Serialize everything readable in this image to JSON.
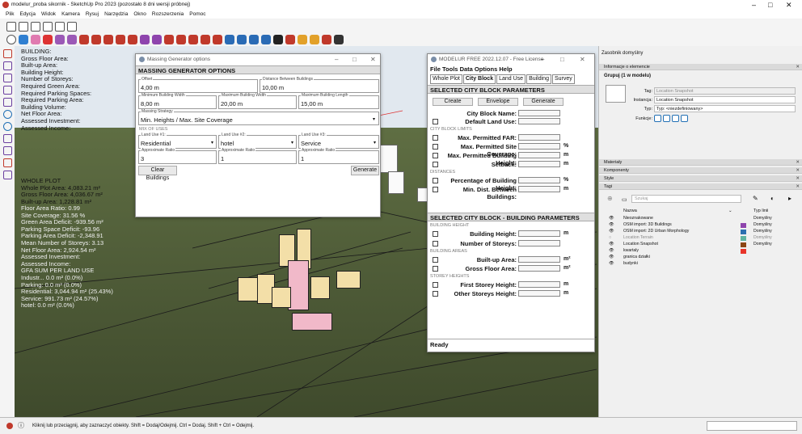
{
  "window": {
    "title": "modelur_proba sikornik - SketchUp Pro 2023 (pozostało 8 dni wersji próbnej)",
    "minimize": "–",
    "maximize": "□",
    "close": "✕"
  },
  "menubar": [
    "Plik",
    "Edycja",
    "Widok",
    "Kamera",
    "Rysuj",
    "Narzędzia",
    "Okno",
    "Rozszerzenia",
    "Pomoc"
  ],
  "viewport_text": {
    "stats": [
      "BUILDING:",
      "Gross Floor Area:",
      "Built-up Area:",
      "Building Height:",
      "Number of Storeys:",
      "Required Green Area:",
      "Required Parking Spaces:",
      "Required Parking Area:",
      "Building Volume:",
      "Net Floor Area:",
      "Assessed Investment:",
      "Assessed Income:"
    ],
    "whole_plot": [
      "WHOLE PLOT",
      "Whole Plot Area: 4,083.21 m²",
      "Gross Floor Area: 4,036.67 m²",
      "Built-up Area: 1,228.81 m²",
      "Floor Area Ratio: 0.99",
      "Site Coverage: 31.56 %",
      "Green Area Deficit: -939.56 m²",
      "Parking Space Deficit: -93.96",
      "Parking Area Deficit: -2,348.91",
      "Mean Number of Storeys: 3.13",
      "Net Floor Area: 2,924.54 m²",
      "Assessed Investment:",
      "Assessed Income:",
      "GFA SUM PER LAND USE",
      "Industr... 0.0 m² (0.0%)",
      "Parking: 0.0 m² (0.0%)",
      "Residential: 3,044.94 m² (25.43%)",
      "Service: 991.73 m² (24.57%)",
      "hotel: 0.0 m² (0.0%)"
    ]
  },
  "massing": {
    "title": "Massing Generator options",
    "header": "MASSING GENERATOR OPTIONS",
    "offset_label": "Offset",
    "offset": "4,00 m",
    "dist_label": "Distance Between Buildings",
    "dist": "10,00 m",
    "minw_label": "Minimum Building Width",
    "minw": "8,00 m",
    "maxw_label": "Maximum Building Width",
    "maxw": "20,00 m",
    "maxl_label": "Maximum Building Length",
    "maxl": "15,00 m",
    "strategy_label": "Massing Strategy",
    "strategy": "Min. Heights / Max. Site Coverage",
    "mix_label": "MIX OF USES",
    "lu1_label": "Land Use #1:",
    "lu1": "Residential",
    "lu2_label": "Land Use #2:",
    "lu2": "hotel",
    "lu3_label": "Land Use #3:",
    "lu3": "Service",
    "r_label": "Approximate Ratio",
    "r1": "3",
    "r2": "1",
    "r3": "1",
    "clear": "Clear Buildings",
    "generate": "Generate"
  },
  "modelur": {
    "title": "MODELUR FREE 2022.12.07 - Free License",
    "menu": [
      "File",
      "Tools",
      "Data",
      "Options",
      "Help"
    ],
    "tabs": [
      "Whole Plot",
      "City Block",
      "Land Use",
      "Building",
      "Survey"
    ],
    "block_header": "SELECTED CITY BLOCK PARAMETERS",
    "create": "Create",
    "envelope": "Envelope",
    "generate": "Generate",
    "name_label": "City Block Name:",
    "default_lu": "Default Land Use:",
    "limits": "CITY BLOCK LIMITS",
    "far": "Max. Permitted FAR:",
    "cov": "Max. Permitted Site Coverage:",
    "bh": "Max. Permitted Building Height:",
    "setback": "Setback:",
    "distances": "DISTANCES",
    "pct": "Percentage of Building Height:",
    "mind": "Min. Dist. Between Buildings:",
    "bb_header": "SELECTED CITY BLOCK - BUILDING PARAMETERS",
    "bheight": "BUILDING HEIGHT",
    "bhl": "Building Height:",
    "ns": "Number of Storeys:",
    "barea": "BUILDING AREAS",
    "bua": "Built-up Area:",
    "gfa": "Gross Floor Area:",
    "sheight": "STOREY HEIGHTS",
    "fsh": "First Storey Height:",
    "osh": "Other Storeys Height:",
    "u_pct": "%",
    "u_m": "m",
    "u_m2": "m²",
    "status": "Ready"
  },
  "panel": {
    "title": "Zasobnik domyślny",
    "info": "Informacje o elemencie",
    "group": "Grupuj (1 w modelu)",
    "tag_label": "Tag:",
    "tag_value": "Location Snapshot",
    "inst_label": "Instancja:",
    "inst_value": "Location Snapshot",
    "type_label": "Typ:",
    "type_value": "Typ: <niezdefiniowany>",
    "fn_label": "Funkcje:",
    "sections": [
      "Materiały",
      "Komponenty",
      "Style",
      "Tagi"
    ],
    "search": "Szukaj",
    "col_name": "Nazwa",
    "col_line": "Typ linii",
    "tags": [
      {
        "name": "Nieoznakowane",
        "line": "Domyślny",
        "color": "#ffffff"
      },
      {
        "name": "OSM import: 3D Buildings",
        "line": "Domyślny",
        "color": "#8e44ad"
      },
      {
        "name": "OSM import: 2D Urban Morphology",
        "line": "Domyślny",
        "color": "#2c6fb0"
      },
      {
        "name": "Location Terrain",
        "line": "Domyślny",
        "color": "#5fb3a0"
      },
      {
        "name": "Location Snapshot",
        "line": "Domyślny",
        "color": "#8b4513"
      },
      {
        "name": "kwartaly",
        "line": "",
        "color": "#e8342a"
      },
      {
        "name": "granica działki",
        "line": "",
        "color": ""
      },
      {
        "name": "budynki",
        "line": "",
        "color": ""
      }
    ]
  },
  "status_text": "Kliknij lub przeciągnij, aby zaznaczyć obiekty. Shift = Dodaj/Odejmij. Ctrl = Dodaj. Shift + Ctrl = Odejmij."
}
